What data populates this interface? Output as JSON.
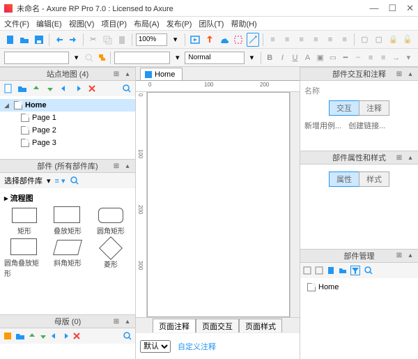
{
  "window": {
    "title": "未命名 - Axure RP Pro 7.0 : Licensed to Axure"
  },
  "menu": {
    "file": "文件(F)",
    "edit": "编辑(E)",
    "view": "视图(V)",
    "project": "项目(P)",
    "arrange": "布局(A)",
    "publish": "发布(P)",
    "team": "团队(T)",
    "help": "帮助(H)"
  },
  "toolbar": {
    "zoom": "100%",
    "font": "",
    "size": "",
    "style": "Normal"
  },
  "panels": {
    "sitemap": {
      "title": "站点地图 (4)"
    },
    "widgets": {
      "title": "部件 (所有部件库)",
      "library": "选择部件库",
      "category": "流程图"
    },
    "masters": {
      "title": "母版 (0)"
    },
    "interactions": {
      "title": "部件交互和注释",
      "name_label": "名称",
      "tab_interact": "交互",
      "tab_notes": "注释",
      "add_case": "新增用例...",
      "create_link": "创建链接..."
    },
    "properties": {
      "title": "部件属性和样式",
      "tab_props": "属性",
      "tab_style": "样式"
    },
    "pagemgr": {
      "title": "部件管理",
      "home": "Home"
    }
  },
  "sitemap": {
    "root": "Home",
    "pages": [
      "Page 1",
      "Page 2",
      "Page 3"
    ]
  },
  "shapes": {
    "rect": "矩形",
    "stackrect": "叠放矩形",
    "roundrect": "圆角矩形",
    "roundstack": "圆角叠放矩形",
    "pararect": "斜角矩形",
    "diamond": "菱形"
  },
  "canvas": {
    "tab": "Home",
    "ruler_h": [
      "0",
      "100",
      "200"
    ],
    "ruler_v": [
      "0",
      "100",
      "200",
      "300"
    ]
  },
  "page_tabs": {
    "notes": "页面注释",
    "interact": "页面交互",
    "style": "页面样式",
    "default": "默认",
    "custom": "自定义注释"
  }
}
